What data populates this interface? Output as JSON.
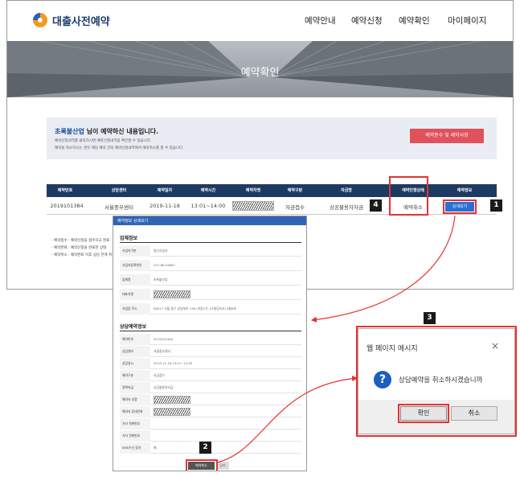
{
  "header": {
    "logo_text": "대출사전예약",
    "nav": [
      "예약안내",
      "예약신청",
      "예약확인",
      "마이페이지"
    ]
  },
  "hero": {
    "title": "예약확인"
  },
  "notice": {
    "title_company": "초록불산업",
    "title_rest": " 님이 예약하신 내용입니다.",
    "lines": [
      "예약신청내역를 클릭하시면 예약신청내역을 확인할 수 있습니다.",
      "예약을 취소하시는 경우 해당 예약 건의 예약신청내역에서 예약취소를 할 수 있습니다."
    ],
    "policy_button": "예약준수 및 제약사항"
  },
  "table": {
    "headers": [
      "예약번호",
      "상담센터",
      "예약일자",
      "예약시간",
      "예약자명",
      "예약구분",
      "자금명",
      "예약진행상태",
      "예약정보"
    ],
    "row": {
      "number": "2019101384",
      "center": "서울중부센터",
      "date": "2019-11-18",
      "time": "13:01~14:00",
      "kind": "자금접수",
      "fund": "상공불용자자금",
      "status": "예약취소",
      "detail_button": "상세보기"
    }
  },
  "legend": [
    "- 예약접수 : 예약신청을 접수하고 완료",
    "- 예약완료 : 예약신청을 완료한 상태",
    "- 예약취소 : 예약완료 이후 상담 전에 취소"
  ],
  "badges": [
    "1",
    "2",
    "3",
    "4"
  ],
  "popup": {
    "title": "예약정보 상세보기",
    "section1": "업체정보",
    "company_rows": [
      {
        "label": "사업자구분",
        "value": "법인사업자"
      },
      {
        "label": "사업자등록번호",
        "value": "107-86-04867"
      },
      {
        "label": "업체명",
        "value": "초록불산업"
      },
      {
        "label": "대표자명",
        "value": ""
      },
      {
        "label": "사업장 주소",
        "value": "08517 서울 중구 삼일대로 238 (저동2가, KT빌딩지사) 8층8호"
      }
    ],
    "section2": "상담예약정보",
    "consult_rows": [
      {
        "label": "예약번호",
        "value": "2019101384"
      },
      {
        "label": "상담센터",
        "value": "서울중부센터"
      },
      {
        "label": "상담일시",
        "value": "2019-11-18 13:01~14:00"
      },
      {
        "label": "예약구분",
        "value": "자금접수"
      },
      {
        "label": "정책자금",
        "value": "상공불용자자금"
      },
      {
        "label": "예약자 성명",
        "value": ""
      },
      {
        "label": "예약자 휴대전화",
        "value": ""
      },
      {
        "label": "기타 전화번호",
        "value": ""
      },
      {
        "label": "기타 전화번호",
        "value": ""
      },
      {
        "label": "SMS수신 동의",
        "value": "예"
      }
    ],
    "cancel_button": "예약취소",
    "close_button": "닫기"
  },
  "dialog": {
    "title": "웹 페이지 메시지",
    "close": "×",
    "question_mark": "?",
    "message": "상담예약을 취소하시겠습니까",
    "ok": "확인",
    "cancel": "취소"
  },
  "colors": {
    "navy": "#1d3a63",
    "red": "#e53232",
    "blue": "#2b6fd1",
    "pink": "#e0515c"
  }
}
